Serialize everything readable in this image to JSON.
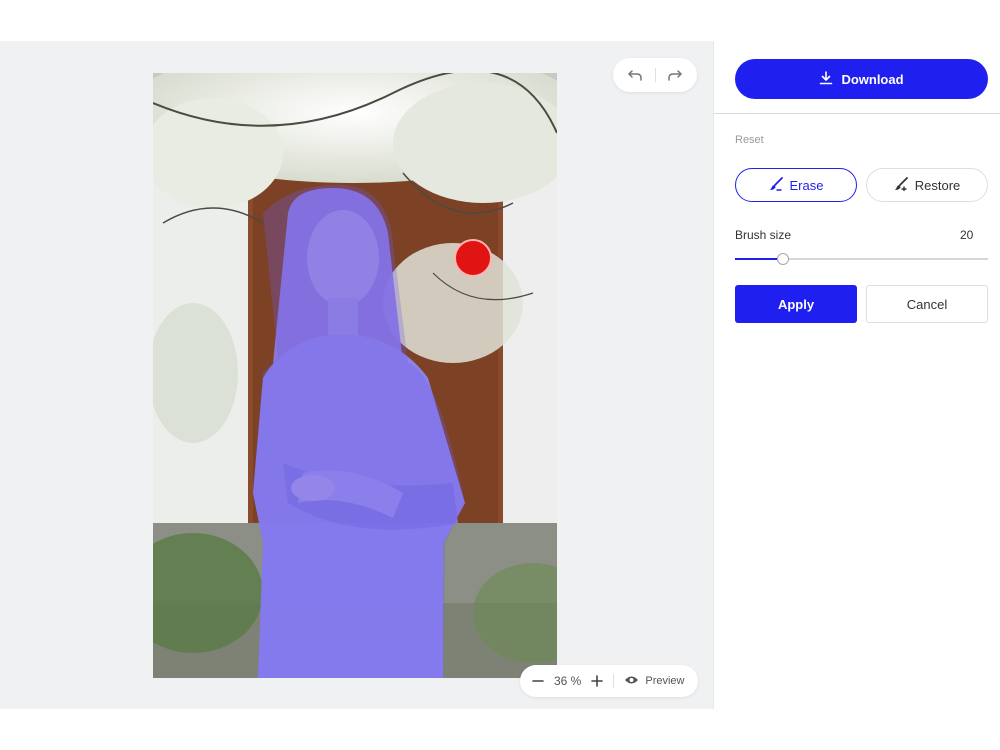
{
  "canvas": {
    "photo_alt": "woman in white sweater in front of flowering tree",
    "undo_icon": "undo-icon",
    "redo_icon": "redo-icon",
    "brush_cursor_color": "#e11414"
  },
  "zoom": {
    "minus_icon": "minus-icon",
    "value": "36 %",
    "plus_icon": "plus-icon",
    "preview_icon": "eye-icon",
    "preview_label": "Preview"
  },
  "sidebar": {
    "download_icon": "download-icon",
    "download_label": "Download",
    "reset_label": "Reset",
    "erase_icon": "brush-erase-icon",
    "erase_label": "Erase",
    "restore_icon": "brush-restore-icon",
    "restore_label": "Restore",
    "brush_size_label": "Brush size",
    "brush_size_value": "20",
    "brush_size_fraction": 0.19,
    "apply_label": "Apply",
    "cancel_label": "Cancel"
  },
  "colors": {
    "accent": "#1f1ff0",
    "mask_overlay": "#7b6cf0",
    "canvas_bg": "#f0f1f3"
  }
}
